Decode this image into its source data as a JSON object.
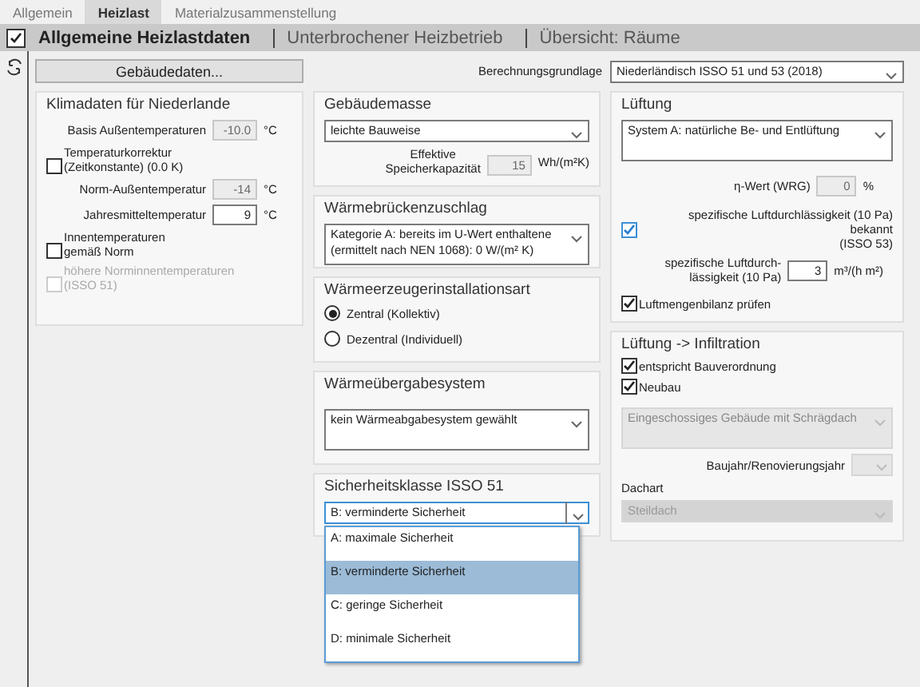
{
  "tabs": [
    {
      "label": "Allgemein",
      "selected": false
    },
    {
      "label": "Heizlast",
      "selected": true
    },
    {
      "label": "Materialzusammenstellung",
      "selected": false
    }
  ],
  "header": {
    "checked": true,
    "items": [
      {
        "label": "Allgemeine Heizlastdaten",
        "selected": true
      },
      {
        "label": "Unterbrochener Heizbetrieb",
        "selected": false
      },
      {
        "label": "Übersicht: Räume",
        "selected": false
      }
    ]
  },
  "building_button": "Gebäudedaten...",
  "basis": {
    "label": "Berechnungsgrundlage",
    "value": "Niederländisch ISSO 51 und 53 (2018)"
  },
  "klimadaten": {
    "title": "Klimadaten für Niederlande",
    "items": [
      {
        "kind": "field",
        "label": "Basis Außentemperaturen",
        "value": "-10.0",
        "unit": "°C",
        "disabled": true
      },
      {
        "kind": "checkbox",
        "label": "Temperaturkorrektur\n(Zeitkonstante) (0.0 K)",
        "checked": false,
        "disabled": false
      },
      {
        "kind": "field",
        "label": "Norm-Außentemperatur",
        "value": "-14",
        "unit": "°C",
        "disabled": true
      },
      {
        "kind": "field",
        "label": "Jahresmitteltemperatur",
        "value": "9",
        "unit": "°C",
        "disabled": false
      },
      {
        "kind": "checkbox",
        "label": "Innentemperaturen\ngemäß Norm",
        "checked": false,
        "disabled": false
      },
      {
        "kind": "checkbox",
        "label": "höhere Norminnentemperaturen\n(ISSO 51)",
        "checked": false,
        "disabled": true
      }
    ]
  },
  "gebaeudemasse": {
    "title": "Gebäudemasse",
    "value": "leichte Bauweise",
    "capacity": {
      "label": "Effektive\nSpeicherkapazität",
      "value": "15",
      "unit": "Wh/(m²K)",
      "disabled": true
    }
  },
  "waermebruecken": {
    "title": "Wärmebrückenzuschlag",
    "value": "Kategorie A: bereits im U-Wert enthaltene (ermittelt nach NEN 1068): 0 W/(m² K)"
  },
  "waermeerzeuger": {
    "title": "Wärmeerzeugerinstallationsart",
    "options": [
      {
        "label": "Zentral (Kollektiv)",
        "selected": true
      },
      {
        "label": "Dezentral (Individuell)",
        "selected": false
      }
    ]
  },
  "waermeuebergabe": {
    "title": "Wärmeübergabesystem",
    "value": "kein Wärmeabgabesystem gewählt"
  },
  "sicherheitsklasse": {
    "title": "Sicherheitsklasse ISSO 51",
    "value": "B: verminderte Sicherheit",
    "expanded": true,
    "options": [
      {
        "label": "A: maximale Sicherheit",
        "selected": false
      },
      {
        "label": "B: verminderte Sicherheit",
        "selected": true
      },
      {
        "label": "C: geringe Sicherheit",
        "selected": false
      },
      {
        "label": "D: minimale Sicherheit",
        "selected": false
      }
    ]
  },
  "lueftung": {
    "title": "Lüftung",
    "value": "System A: natürliche Be- und Entlüftung",
    "wrg": {
      "label": "η-Wert (WRG)",
      "value": "0",
      "unit": "%",
      "disabled": true
    },
    "leak_known": {
      "label": "spezifische Luftdurchlässigkeit (10 Pa) bekannt\n(ISSO 53)",
      "checked": true
    },
    "leak": {
      "label": "spezifische Luftdurch-\nlässigkeit (10 Pa)",
      "value": "3",
      "unit": "m³/(h m²)",
      "disabled": false
    },
    "balance": {
      "label": "Luftmengenbilanz prüfen",
      "checked": true
    }
  },
  "infiltration": {
    "title": "Lüftung -> Infiltration",
    "checks": [
      {
        "label": "entspricht Bauverordnung",
        "checked": true
      },
      {
        "label": "Neubau",
        "checked": true
      }
    ],
    "building_type": {
      "value": "Eingeschossiges Gebäude mit Schrägdach",
      "disabled": true
    },
    "year": {
      "label": "Baujahr/Renovierungsjahr",
      "disabled": true
    },
    "roof": {
      "label": "Dachart",
      "value": "Steildach",
      "disabled": true
    }
  }
}
